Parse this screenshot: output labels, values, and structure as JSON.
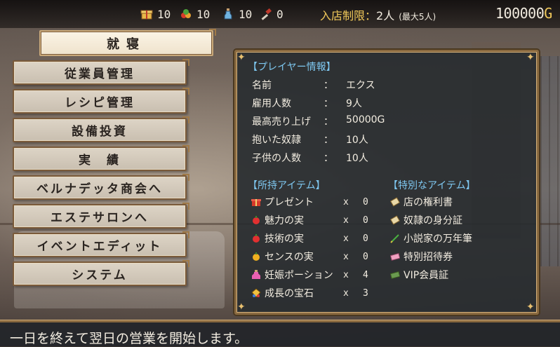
{
  "topbar": {
    "resources": [
      {
        "icon": "gift-box-icon",
        "value": "10"
      },
      {
        "icon": "berries-icon",
        "value": "10"
      },
      {
        "icon": "potion-bottle-icon",
        "value": "10"
      },
      {
        "icon": "hammer-icon",
        "value": "0"
      }
    ],
    "limit_label": "入店制限：",
    "limit_value": "2人",
    "limit_max": "(最大5人)",
    "gold_amount": "100000",
    "gold_unit": "G"
  },
  "menu": {
    "sleep": "就寝",
    "items": [
      "従業員管理",
      "レシピ管理",
      "設備投資",
      "実　績",
      "ベルナデッタ商会へ",
      "エステサロンへ",
      "イベントエディット",
      "システム"
    ]
  },
  "panel": {
    "player_title": "【プレイヤー情報】",
    "player_rows": [
      {
        "label": "名前",
        "value": "エクス"
      },
      {
        "label": "雇用人数",
        "value": "9人"
      },
      {
        "label": "最高売り上げ",
        "value": "50000G"
      },
      {
        "label": "抱いた奴隷",
        "value": "10人"
      },
      {
        "label": "子供の人数",
        "value": "10人"
      }
    ],
    "colon": "：",
    "items_title": "【所持アイテム】",
    "items": [
      {
        "icon": "present-icon",
        "name": "プレゼント",
        "x": "x",
        "count": "0"
      },
      {
        "icon": "charm-fruit-icon",
        "name": "魅力の実",
        "x": "x",
        "count": "0"
      },
      {
        "icon": "skill-fruit-icon",
        "name": "技術の実",
        "x": "x",
        "count": "0"
      },
      {
        "icon": "sense-fruit-icon",
        "name": "センスの実",
        "x": "x",
        "count": "0"
      },
      {
        "icon": "pregnancy-potion-icon",
        "name": "妊娠ポーション",
        "x": "x",
        "count": "4"
      },
      {
        "icon": "growth-gem-icon",
        "name": "成長の宝石",
        "x": "x",
        "count": "3"
      }
    ],
    "special_title": "【特別なアイテム】",
    "special_items": [
      {
        "icon": "scroll-icon",
        "name": "店の権利書"
      },
      {
        "icon": "scroll-icon",
        "name": "奴隷の身分証"
      },
      {
        "icon": "pen-icon",
        "name": "小説家の万年筆"
      },
      {
        "icon": "ticket-icon",
        "name": "特別招待券"
      },
      {
        "icon": "card-icon",
        "name": "VIP会員証"
      }
    ]
  },
  "message": "一日を終えて翌日の営業を開始します。",
  "colors": {
    "accent_gold": "#f0c85a",
    "section_blue": "#7ec7f0",
    "frame": "#8a6a40"
  }
}
